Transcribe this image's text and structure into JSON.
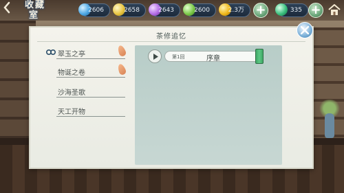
{
  "nav": {
    "back_icon": "back-arrow-icon",
    "collection_label_top": "收藏",
    "collection_label_bottom": "室"
  },
  "resources": [
    {
      "icon": "blue-gem-icon",
      "color": "#4fa9e6",
      "value": "2606"
    },
    {
      "icon": "yellow-gem-icon",
      "color": "#e9c541",
      "value": "2658"
    },
    {
      "icon": "purple-gem-icon",
      "color": "#b46ee6",
      "value": "2643"
    },
    {
      "icon": "green-gem-icon",
      "color": "#7cc94a",
      "value": "2600"
    },
    {
      "icon": "gold-coin-icon",
      "color": "#f1b91c",
      "value": "2.3万"
    },
    {
      "icon": "jade-gem-icon",
      "color": "#3cc07f",
      "value": "335"
    }
  ],
  "panel": {
    "title": "茶修追忆"
  },
  "chapters": [
    {
      "label": "翠玉之亭",
      "selected": true,
      "has_leaf": true
    },
    {
      "label": "物诞之卷",
      "selected": false,
      "has_leaf": true
    },
    {
      "label": "沙海圣歌",
      "selected": false,
      "has_leaf": false
    },
    {
      "label": "天工开物",
      "selected": false,
      "has_leaf": false
    }
  ],
  "episode": {
    "number": "第1回",
    "title": "序章"
  },
  "colors": {
    "accent": "#3fa866",
    "panel_bg": "#f4f3ec",
    "content_bg": "#b8cdc8"
  }
}
